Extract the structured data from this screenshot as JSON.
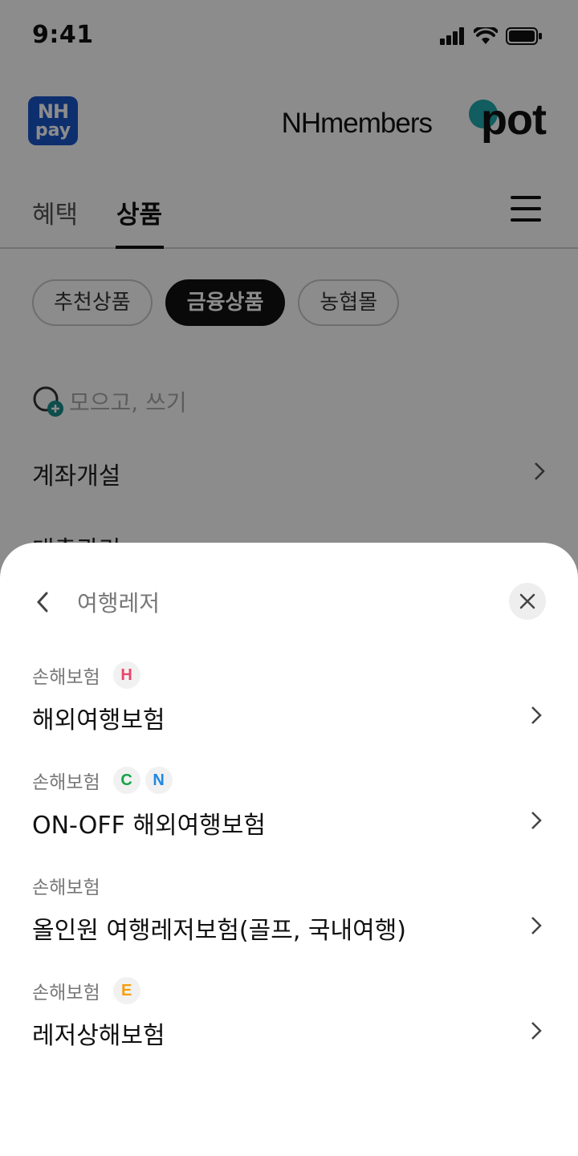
{
  "status": {
    "time": "9:41"
  },
  "header": {
    "nhpay_logo_line1": "NH",
    "nhpay_logo_line2": "pay",
    "brand_text": "NHmembers",
    "brand_pot": "pot"
  },
  "tabs": [
    {
      "label": "혜택",
      "active": false
    },
    {
      "label": "상품",
      "active": true
    }
  ],
  "chips": [
    {
      "label": "추천상품",
      "active": false
    },
    {
      "label": "금융상품",
      "active": true
    },
    {
      "label": "농협몰",
      "active": false
    }
  ],
  "collect_label": "모으고, 쓰기",
  "menu_rows": [
    "계좌개설",
    "대출관리"
  ],
  "sheet": {
    "title": "여행레저",
    "items": [
      {
        "category": "손해보험",
        "title": "해외여행보험",
        "badges": [
          {
            "letter": "H",
            "color": "#e8466b"
          }
        ]
      },
      {
        "category": "손해보험",
        "title": "ON-OFF 해외여행보험",
        "badges": [
          {
            "letter": "C",
            "color": "#16a34a"
          },
          {
            "letter": "N",
            "color": "#1e88e5"
          }
        ]
      },
      {
        "category": "손해보험",
        "title": "올인원 여행레저보험(골프, 국내여행)",
        "badges": []
      },
      {
        "category": "손해보험",
        "title": "레저상해보험",
        "badges": [
          {
            "letter": "E",
            "color": "#f59e0b"
          }
        ]
      }
    ]
  },
  "colors": {
    "nhpay_blue": "#1a56c8",
    "pot_teal": "#20a9ad",
    "chip_active": "#111111"
  }
}
